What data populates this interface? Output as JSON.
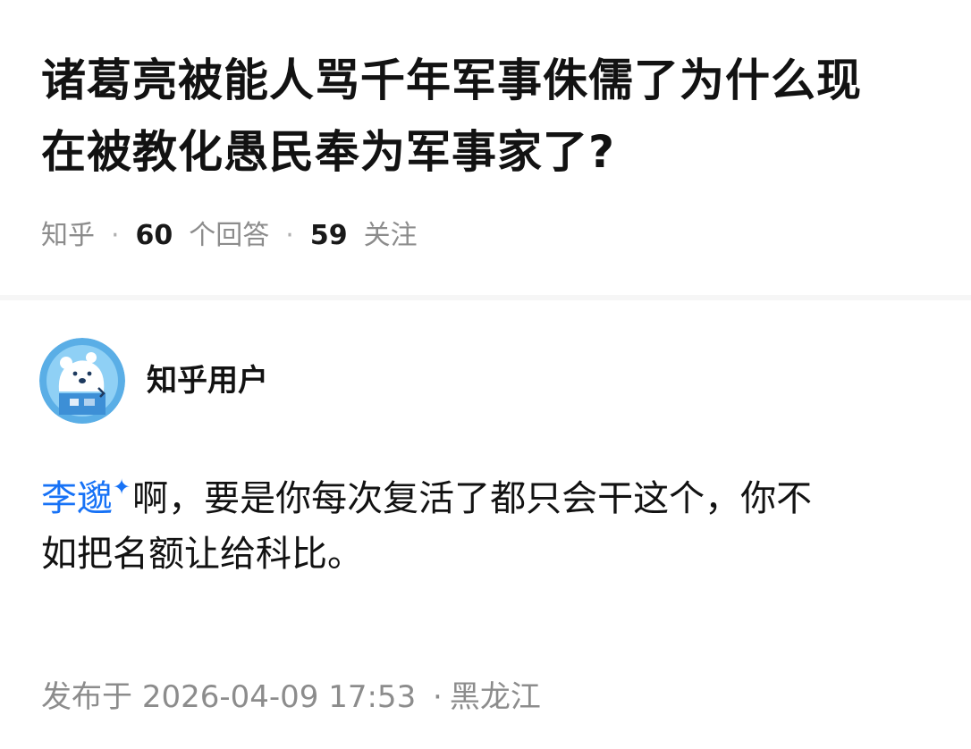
{
  "question": {
    "title_line1": "诸葛亮被能人骂千年军事侏儒了为什么现",
    "title_line2": "在被教化愚民奉为军事家了?",
    "source": "知乎",
    "answer_count": "60",
    "answer_label": "个回答",
    "follow_count": "59",
    "follow_label": "关注"
  },
  "answer": {
    "author_name": "知乎用户",
    "mention": "李邈",
    "content_line1": "啊，要是你每次复活了都只会干这个，你不",
    "content_line2": "如把名额让给科比。",
    "publish_label": "发布于",
    "publish_time": "2026-04-09  17:53",
    "location": "黑龙江"
  },
  "colors": {
    "accent": "#1772f6",
    "muted_text": "#8c8c8c",
    "avatar_bg": "#5aaee6"
  },
  "icons": {
    "avatar": "zhihu-default-bear-avatar",
    "mention_badge": "sparkle-icon"
  }
}
